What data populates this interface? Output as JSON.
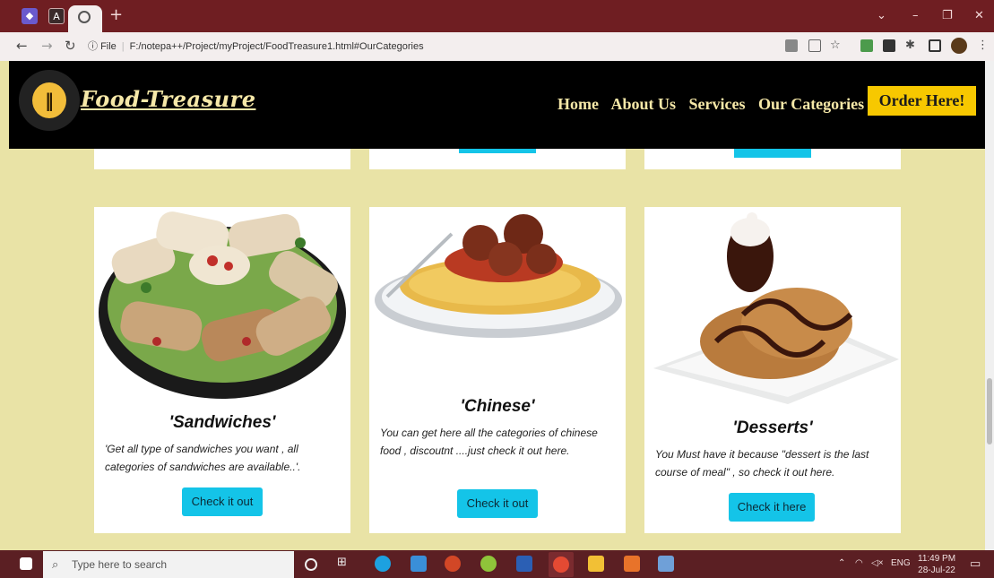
{
  "browser": {
    "address_prefix": "File",
    "url": "F:/notepa++/Project/myProject/FoodTreasure1.html#OurCategories"
  },
  "site": {
    "brand": "Food-Treasure",
    "nav": [
      "Home",
      "About Us",
      "Services",
      "Our Categories"
    ],
    "order_button": "Order Here!"
  },
  "cards": [
    {
      "title": "'Sandwiches'",
      "description": "'Get all type of sandwiches you want , all categories of sandwiches are available..'.",
      "button": "Check it out",
      "image_icon": "sandwich-platter-image"
    },
    {
      "title": "'Chinese'",
      "description": "You can get here all the categories of chinese food , discoutnt ....just check it out here.",
      "button": "Check it out",
      "image_icon": "spaghetti-meatballs-image"
    },
    {
      "title": "'Desserts'",
      "description": "You Must have it because \"dessert is the last course of meal\" , so check it out here.",
      "button": "Check it here",
      "image_icon": "chocolate-dessert-image"
    }
  ],
  "taskbar": {
    "search_placeholder": "Type here to search",
    "language": "ENG",
    "time": "11:49 PM",
    "date": "28-Jul-22"
  },
  "colors": {
    "page_bg": "#e9e3a6",
    "header_bg": "#000000",
    "accent_button": "#14c4e8",
    "order_button": "#f7c800",
    "brand_text": "#f6e8a8"
  }
}
